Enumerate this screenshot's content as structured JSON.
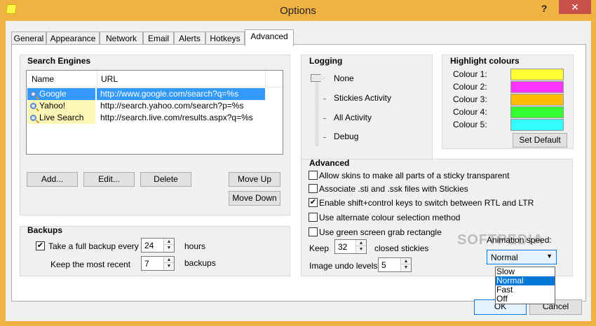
{
  "window": {
    "title": "Options",
    "help": "?",
    "close": "✕"
  },
  "tabs": [
    "General",
    "Appearance",
    "Network",
    "Email",
    "Alerts",
    "Hotkeys",
    "Advanced"
  ],
  "active_tab": "Advanced",
  "search_engines": {
    "title": "Search Engines",
    "columns": [
      "Name",
      "URL"
    ],
    "rows": [
      {
        "name": "Google",
        "url": "http://www.google.com/search?q=%s",
        "selected": true
      },
      {
        "name": "Yahoo!",
        "url": "http://search.yahoo.com/search?p=%s",
        "selected": false
      },
      {
        "name": "Live Search",
        "url": "http://search.live.com/results.aspx?q=%s",
        "selected": false
      }
    ],
    "buttons": {
      "add": "Add...",
      "edit": "Edit...",
      "delete": "Delete",
      "move_up": "Move Up",
      "move_down": "Move Down"
    }
  },
  "backups": {
    "title": "Backups",
    "full_backup_label": "Take a full backup every",
    "full_backup_checked": true,
    "full_backup_value": "24",
    "hours_label": "hours",
    "keep_label": "Keep the most recent",
    "keep_value": "7",
    "backups_label": "backups"
  },
  "logging": {
    "title": "Logging",
    "levels": [
      "None",
      "Stickies Activity",
      "All Activity",
      "Debug"
    ],
    "selected": "None"
  },
  "highlight": {
    "title": "Highlight colours",
    "colours": [
      {
        "label": "Colour 1:",
        "color": "#ffff33"
      },
      {
        "label": "Colour 2:",
        "color": "#ff33ff"
      },
      {
        "label": "Colour 3:",
        "color": "#ffbb00"
      },
      {
        "label": "Colour 4:",
        "color": "#33ff33"
      },
      {
        "label": "Colour 5:",
        "color": "#33ffff"
      }
    ],
    "set_default": "Set Default"
  },
  "advanced": {
    "title": "Advanced",
    "options": [
      {
        "label": "Allow skins to make all parts of a sticky transparent",
        "checked": false
      },
      {
        "label": "Associate .sti and .ssk files with Stickies",
        "checked": false
      },
      {
        "label": "Enable shift+control keys to switch between RTL and LTR",
        "checked": true
      },
      {
        "label": "Use alternate colour selection method",
        "checked": false
      },
      {
        "label": "Use green screen grab rectangle",
        "checked": false
      }
    ],
    "keep_label": "Keep",
    "keep_value": "32",
    "closed_label": "closed stickies",
    "undo_label": "Image undo levels:",
    "undo_value": "5",
    "animation_label": "Animation speed:",
    "animation_value": "Normal",
    "animation_options": [
      "Slow",
      "Normal",
      "Fast",
      "Off"
    ]
  },
  "watermark": "SOFTPEDIA",
  "footer": {
    "ok": "OK",
    "cancel": "Cancel"
  }
}
